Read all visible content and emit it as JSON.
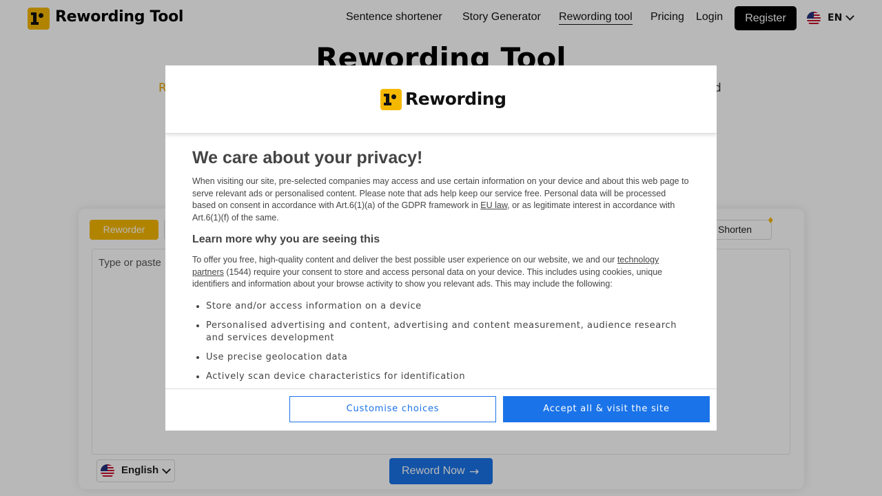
{
  "header": {
    "site_title": "Rewording Tool",
    "nav": [
      "Sentence shortener",
      "Story Generator",
      "Rewording tool",
      "Pricing",
      "Login"
    ],
    "active_nav": "Rewording tool",
    "register_label": "Register",
    "language_code": "EN",
    "flag_icon": "us-flag-icon"
  },
  "page": {
    "title": "Rewording Tool",
    "subtitle_left_fragment": "R",
    "subtitle_right_fragment": "d"
  },
  "tool": {
    "mode_active": "Reworder",
    "mode_shorten": "Shorten",
    "editor_placeholder": "Type or paste",
    "language_label": "English",
    "submit_label": "Reword Now",
    "accent_color": "#f5b800",
    "primary_color": "#1a73e8"
  },
  "consent": {
    "brand": "Rewording",
    "heading": "We care about your privacy!",
    "intro_before_link": "When visiting our site, pre-selected companies may access and use certain information on your device and about this web page to serve relevant ads or personalised content. Please note that ads help keep our service free. Personal data will be processed based on consent in accordance with Art.6(1)(a) of the GDPR framework in ",
    "intro_link": "EU law",
    "intro_after_link": ", or as legitimate interest in accordance with Art.6(1)(f) of the same.",
    "learn_more": "Learn more why you are seeing this",
    "offer_before_link": "To offer you free, high-quality content and deliver the best possible user experience on our website, we and our ",
    "offer_link": "technology partners",
    "offer_after_link": " (1544) require your consent to store and access personal data on your device. This includes using cookies, unique identifiers and information about your browse activity to show you relevant ads. This may include the following:",
    "purposes": [
      "Store and/or access information on a device",
      "Personalised advertising and content, advertising and content measurement, audience research and services development",
      "Use precise geolocation data",
      "Actively scan device characteristics for identification"
    ],
    "customise_label": "Customise choices",
    "accept_label": "Accept all & visit the site"
  }
}
